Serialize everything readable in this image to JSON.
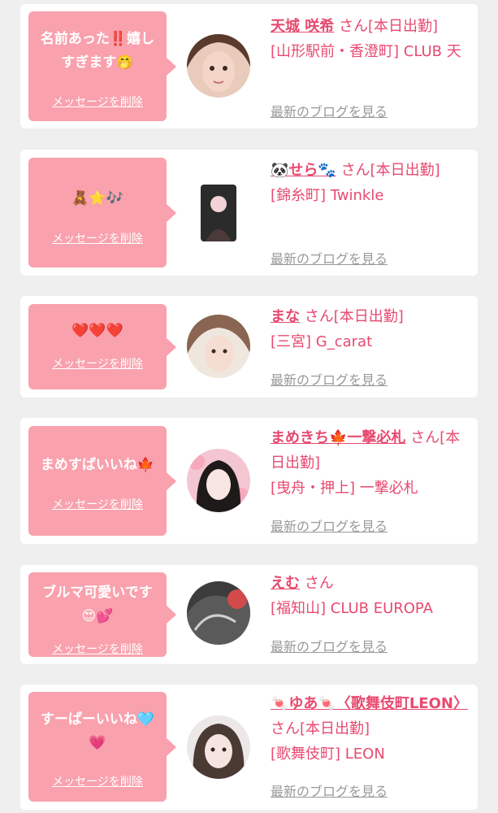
{
  "messages": [
    {
      "text": "名前あった‼️嬉し\nすぎます🤭",
      "delete_label": "メッセージを削除",
      "username": "天城 咲希",
      "status": "さん[本日出勤]",
      "shop": "[山形駅前・香澄町] CLUB 天",
      "blog_label": "最新のブログを見る"
    },
    {
      "text": "🧸⭐🎶",
      "delete_label": "メッセージを削除",
      "username": "🐼せら🐾",
      "status": "さん[本日出勤]",
      "shop": "[錦糸町] Twinkle",
      "blog_label": "最新のブログを見る"
    },
    {
      "text": "❤️❤️❤️",
      "delete_label": "メッセージを削除",
      "username": "まな",
      "status": "さん[本日出勤]",
      "shop": "[三宮] G_carat",
      "blog_label": "最新のブログを見る"
    },
    {
      "text": "まめすぱいいね🍁",
      "delete_label": "メッセージを削除",
      "username": "まめきち🍁一撃必札",
      "status": "さん[本日出勤]",
      "shop": "[曳舟・押上] 一撃必札",
      "blog_label": "最新のブログを見る"
    },
    {
      "text": "ブルマ可愛いです\n😍💕",
      "delete_label": "メッセージを削除",
      "username": "えむ",
      "status": "さん",
      "shop": "[福知山] CLUB EUROPA",
      "blog_label": "最新のブログを見る"
    },
    {
      "text": "すーぱーいいね🩵\n💗",
      "delete_label": "メッセージを削除",
      "username": "🍬ゆあ🍬〈歌舞伎町LEON〉",
      "status": "さん[本日出勤]",
      "shop": "[歌舞伎町] LEON",
      "blog_label": "最新のブログを見る"
    }
  ],
  "colors": {
    "bubble": "#f9a1ad",
    "accent": "#e84a6f",
    "muted": "#999999",
    "background": "#efefef"
  },
  "icons": [
    "avatar-photo",
    "message-bubble-tail"
  ]
}
